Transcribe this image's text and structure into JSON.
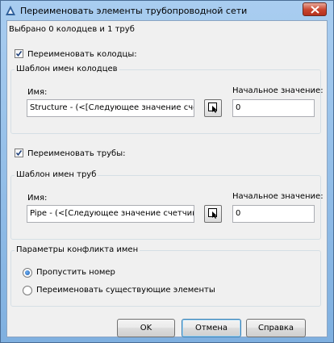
{
  "window": {
    "title": "Переименовать элементы трубопроводной сети"
  },
  "summary": "Выбрано 0 колодцев и 1 труб",
  "structures": {
    "checkbox_label": "Переименовать колодцы:",
    "checked": true,
    "group_title": "Шаблон имен колодцев",
    "name_label": "Имя:",
    "name_value": "Structure - (<[Следующее значение сче",
    "start_label": "Начальное значение:",
    "start_value": "0"
  },
  "pipes": {
    "checkbox_label": "Переименовать трубы:",
    "checked": true,
    "group_title": "Шаблон имен труб",
    "name_label": "Имя:",
    "name_value": "Pipe - (<[Следующее значение счетчик",
    "start_label": "Начальное значение:",
    "start_value": "0"
  },
  "conflict": {
    "group_title": "Параметры конфликта имен",
    "options": [
      {
        "label": "Пропустить номер",
        "selected": true
      },
      {
        "label": "Переименовать существующие элементы",
        "selected": false
      }
    ]
  },
  "buttons": {
    "ok": "OK",
    "cancel": "Отмена",
    "help": "Справка"
  },
  "colors": {
    "titlebar": "#a9cdf0",
    "close": "#c8432c",
    "client": "#f0f0f0"
  }
}
